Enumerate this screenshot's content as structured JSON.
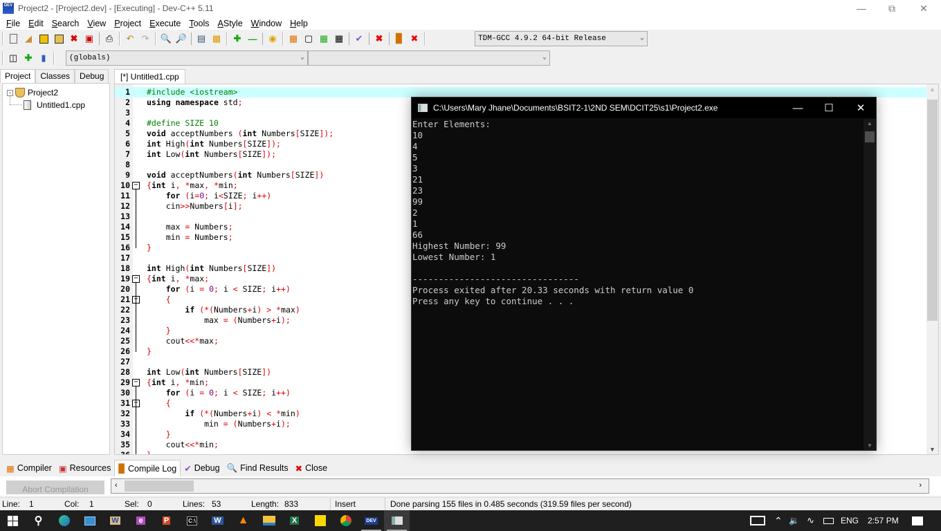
{
  "window": {
    "title": "Project2 - [Project2.dev] - [Executing] - Dev-C++ 5.11",
    "app_icon_label": "DEV"
  },
  "menu": [
    {
      "label": "File",
      "ul": "F",
      "rest": "ile"
    },
    {
      "label": "Edit",
      "ul": "E",
      "rest": "dit"
    },
    {
      "label": "Search",
      "ul": "S",
      "rest": "earch"
    },
    {
      "label": "View",
      "ul": "V",
      "rest": "iew"
    },
    {
      "label": "Project",
      "ul": "P",
      "rest": "roject"
    },
    {
      "label": "Execute",
      "ul": "E",
      "rest": "xecute",
      "pre": ""
    },
    {
      "label": "Tools",
      "ul": "T",
      "rest": "ools"
    },
    {
      "label": "AStyle",
      "ul": "A",
      "rest": "Style"
    },
    {
      "label": "Window",
      "ul": "W",
      "rest": "indow"
    },
    {
      "label": "Help",
      "ul": "H",
      "rest": "elp"
    }
  ],
  "toolbar": {
    "compiler_select": "TDM-GCC 4.9.2 64-bit Release",
    "scope_select": "(globals)",
    "function_select": ""
  },
  "left_panel": {
    "tabs": [
      "Project",
      "Classes",
      "Debug"
    ],
    "active_tab": "Project",
    "tree": {
      "project": "Project2",
      "files": [
        "Untitled1.cpp"
      ]
    }
  },
  "editor": {
    "tab_label": "[*] Untitled1.cpp",
    "current_line": 1,
    "lines": [
      "#include <iostream>",
      "using namespace std;",
      "",
      "#define SIZE 10",
      "void acceptNumbers (int Numbers[SIZE]);",
      "int High(int Numbers[SIZE]);",
      "int Low(int Numbers[SIZE]);",
      "",
      "void acceptNumbers(int Numbers[SIZE])",
      "{int i, *max, *min;",
      "    for (i=0; i<SIZE; i++)",
      "    cin>>Numbers[i];",
      "",
      "    max = Numbers;",
      "    min = Numbers;",
      "}",
      "",
      "int High(int Numbers[SIZE])",
      "{int i, *max;",
      "    for (i = 0; i < SIZE; i++)",
      "    {",
      "        if (*(Numbers+i) > *max)",
      "            max = (Numbers+i);",
      "    }",
      "    cout<<*max;",
      "}",
      "",
      "int Low(int Numbers[SIZE])",
      "{int i, *min;",
      "    for (i = 0; i < SIZE; i++)",
      "    {",
      "        if (*(Numbers+i) < *min)",
      "            min = (Numbers+i);",
      "    }",
      "    cout<<*min;",
      "}"
    ]
  },
  "console": {
    "title": "C:\\Users\\Mary Jhane\\Documents\\BSIT2-1\\2ND SEM\\DCIT25\\s1\\Project2.exe",
    "output": [
      "Enter Elements:",
      "10",
      "4",
      "5",
      "3",
      "21",
      "23",
      "99",
      "2",
      "1",
      "66",
      "Highest Number: 99",
      "Lowest Number: 1",
      "",
      "--------------------------------",
      "Process exited after 20.33 seconds with return value 0",
      "Press any key to continue . . ."
    ]
  },
  "bottom_tabs": [
    {
      "label": "Compiler",
      "icon": "grid-icon"
    },
    {
      "label": "Resources",
      "icon": "resources-icon"
    },
    {
      "label": "Compile Log",
      "icon": "bar-chart-icon",
      "active": true
    },
    {
      "label": "Debug",
      "icon": "check-icon"
    },
    {
      "label": "Find Results",
      "icon": "find-icon"
    },
    {
      "label": "Close",
      "icon": "close-icon"
    }
  ],
  "bottom_panel": {
    "abort_button": "Abort Compilation"
  },
  "status": {
    "line_label": "Line:",
    "line": "1",
    "col_label": "Col:",
    "col": "1",
    "sel_label": "Sel:",
    "sel": "0",
    "lines_label": "Lines:",
    "lines": "53",
    "length_label": "Length:",
    "length": "833",
    "mode": "Insert",
    "message": "Done parsing 155 files in 0.485 seconds (319.59 files per second)"
  },
  "taskbar": {
    "apps": [
      "start",
      "search",
      "edge",
      "app-tile",
      "winword-old",
      "onenote",
      "powerpoint",
      "cmd",
      "word",
      "vlc",
      "file-explorer",
      "excel",
      "sticky-notes",
      "chrome",
      "devcpp",
      "console"
    ],
    "tray": {
      "language": "ENG",
      "time": "2:57 PM"
    }
  }
}
